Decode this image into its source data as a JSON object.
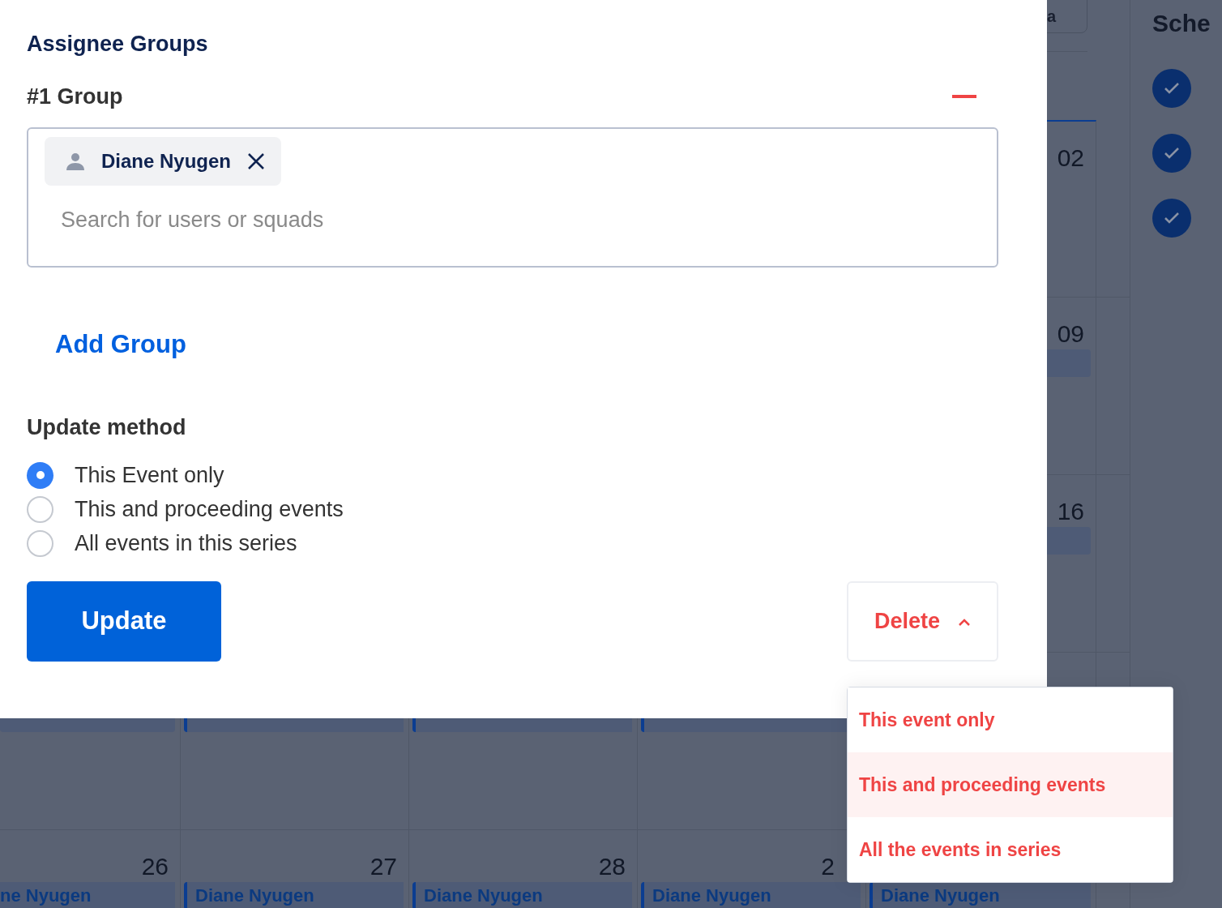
{
  "background": {
    "top_button": "a",
    "weeks": [
      {
        "cells": [
          {},
          {},
          {},
          {},
          {
            "date": "02"
          }
        ]
      },
      {
        "cells": [
          {},
          {},
          {},
          {},
          {
            "date": "09",
            "bar": true
          }
        ]
      },
      {
        "cells": [
          {},
          {},
          {},
          {},
          {
            "date": "16",
            "bar": true
          }
        ]
      },
      {
        "cells": [
          {
            "bar": true
          },
          {
            "bar": true
          },
          {
            "bar": true
          },
          {
            "bar": true
          },
          {}
        ]
      },
      {
        "cells": [
          {
            "date": "26",
            "event": "ne Nyugen"
          },
          {
            "date": "27",
            "event": "Diane Nyugen"
          },
          {
            "date": "28",
            "event": "Diane Nyugen"
          },
          {
            "date": "2",
            "event": "Diane Nyugen"
          },
          {
            "event": "Diane Nyugen"
          }
        ]
      }
    ],
    "schedule": {
      "title": "Sche",
      "items": [
        {
          "checked": true
        },
        {
          "checked": true
        },
        {
          "checked": true
        }
      ]
    }
  },
  "modal": {
    "title": "Assignee Groups",
    "groups": [
      {
        "title": "#1 Group",
        "assignees": [
          {
            "name": "Diane Nyugen"
          }
        ],
        "placeholder": "Search for users or squads"
      }
    ],
    "add_group": "Add Group",
    "update_method": {
      "title": "Update method",
      "options": [
        {
          "label": "This Event only",
          "selected": true
        },
        {
          "label": "This and proceeding events",
          "selected": false
        },
        {
          "label": "All events in this series",
          "selected": false
        }
      ]
    },
    "update_button": "Update",
    "delete_button": {
      "label": "Delete",
      "expanded": true
    },
    "delete_menu": [
      {
        "label": "This event only",
        "selected": false
      },
      {
        "label": "This and proceeding events",
        "selected": true
      },
      {
        "label": "All the events in series",
        "selected": false
      }
    ]
  }
}
